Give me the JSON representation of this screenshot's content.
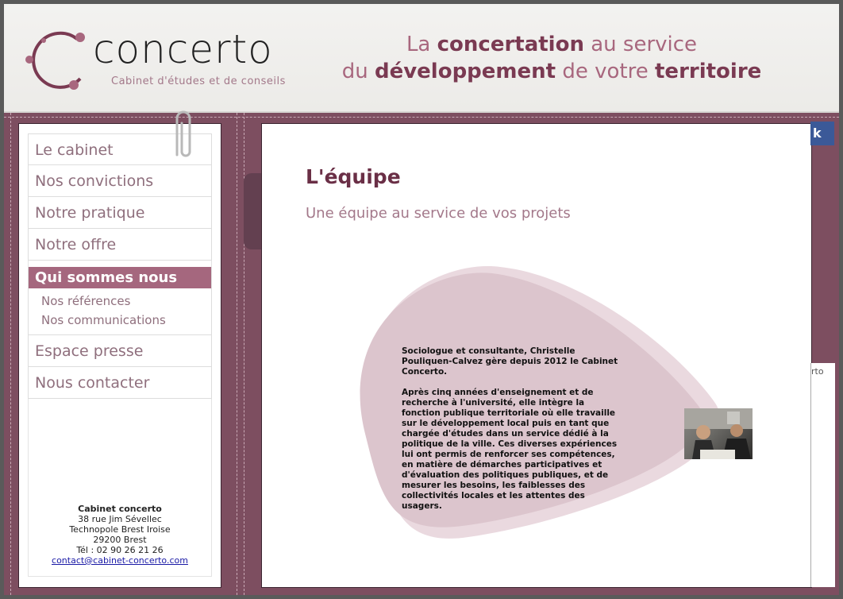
{
  "header": {
    "logo_text": "concerto",
    "logo_subtitle": "Cabinet d'études et de conseils",
    "tagline": {
      "line1_a": "La ",
      "line1_bold": "concertation",
      "line1_b": " au service",
      "line2_a": "du ",
      "line2_bold": "développement",
      "line2_b": " de votre ",
      "line2_bold2": "territoire"
    }
  },
  "sidebar": {
    "menu": [
      {
        "label": "Le cabinet"
      },
      {
        "label": "Nos convictions"
      },
      {
        "label": "Notre pratique"
      },
      {
        "label": "Notre offre"
      }
    ],
    "active": "Qui sommes nous",
    "submenu": [
      {
        "label": "Nos références"
      },
      {
        "label": "Nos communications"
      }
    ],
    "menu_bottom": [
      {
        "label": "Espace presse"
      },
      {
        "label": "Nous contacter"
      }
    ],
    "address": {
      "name": "Cabinet concerto",
      "street": "38 rue Jim Sévellec",
      "park": "Technopole Brest Iroise",
      "city": "29200 Brest",
      "phone": "Tél : 02 90 26 21 26",
      "email": "contact@cabinet-concerto.com"
    }
  },
  "main": {
    "title": "L'équipe",
    "subtitle": "Une équipe au service de vos projets",
    "bio_p1": "Sociologue et consultante, Christelle Pouliquen-Calvez gère depuis 2012 le Cabinet Concerto.",
    "bio_p2": "Après cinq années d'enseignement et de recherche à l'université, elle intègre la fonction publique territoriale où elle travaille sur le développement local puis en tant que chargée d'études dans un service dédié à la politique de la ville. Ces diverses expériences lui ont permis de renforcer ses compétences, en matière de démarches participatives et d'évaluation des politiques publiques, et de mesurer les besoins, les faiblesses des collectivités locales et les attentes des usagers."
  },
  "side": {
    "prev_arrow": "〈",
    "facebook_tab": "k",
    "right_tab": "rto"
  },
  "colors": {
    "accent": "#a5677e",
    "title": "#6a2f46",
    "leather": "#7d4e60",
    "blob": "#dcc5cd"
  }
}
